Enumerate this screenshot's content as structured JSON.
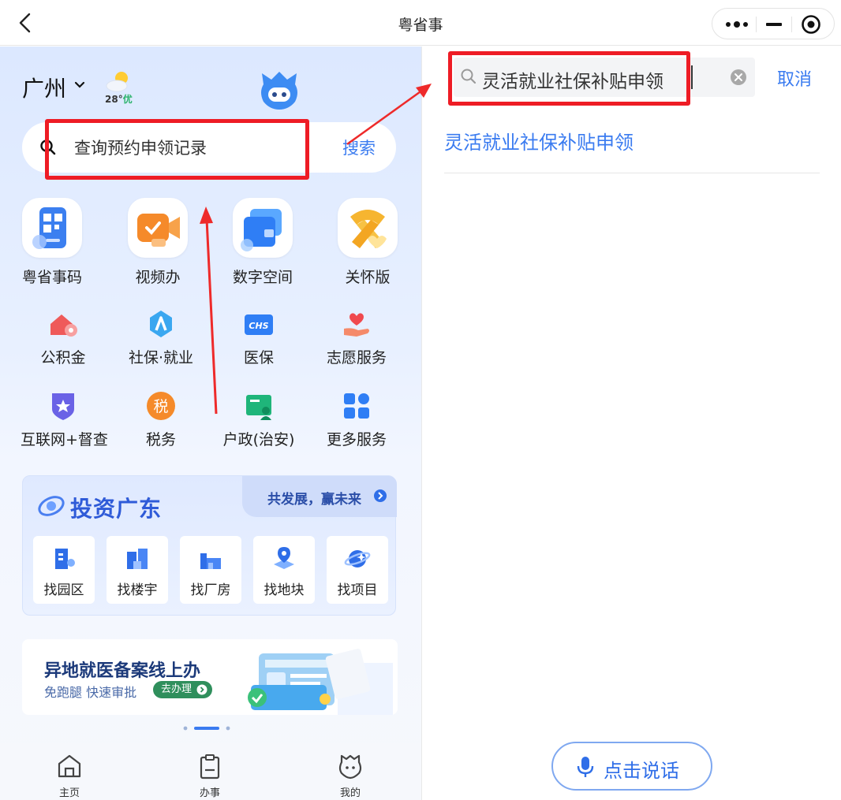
{
  "titlebar": {
    "title": "粤省事"
  },
  "left": {
    "city": "广州",
    "weather": {
      "temp": "28°",
      "quality": "优"
    },
    "search": {
      "placeholder": "查询预约申领记录",
      "button": "搜索"
    },
    "top_apps": [
      "粤省事码",
      "视频办",
      "数字空间",
      "关怀版"
    ],
    "services_row1": [
      "公积金",
      "社保·就业",
      "医保",
      "志愿服务"
    ],
    "services_row2": [
      "互联网+督查",
      "税务",
      "户政(治安)",
      "更多服务"
    ],
    "tax_glyph": "税",
    "chs_label": "CHS",
    "invest": {
      "title": "投资广东",
      "slogan": "共发展，赢未来",
      "items": [
        "找园区",
        "找楼宇",
        "找厂房",
        "找地块",
        "找项目"
      ]
    },
    "banner": {
      "title": "异地就医备案线上办",
      "subtitle": "免跑腿 快速审批",
      "button": "去办理"
    },
    "tabs": [
      "主页",
      "办事",
      "我的"
    ]
  },
  "right": {
    "search_value": "灵活就业社保补贴申领",
    "cancel": "取消",
    "result": "灵活就业社保补贴申领",
    "voice_button": "点击说话"
  },
  "colors": {
    "accent": "#3a7bf0",
    "highlight_box": "#ee1c25",
    "title_blue": "#2f5bd8"
  }
}
